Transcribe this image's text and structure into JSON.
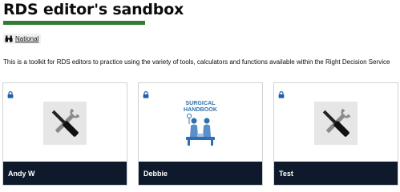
{
  "page": {
    "title": "RDS editor's sandbox",
    "tag_label": "National",
    "intro": "This is a toolkit for RDS editors to practice using the variety of tools, calculators and functions available within the Right Decision Service"
  },
  "colors": {
    "title_underline": "#2e7d32",
    "card_footer": "#0e1a2b",
    "lock": "#1d5fa8",
    "book_accent": "#2f6fb0"
  },
  "cards": [
    {
      "name": "Andy W",
      "thumbnail": "tools-icon",
      "locked": true
    },
    {
      "name": "Debbie",
      "thumbnail": "surgical-handbook-cover",
      "locked": true,
      "cover_title_line1": "SURGICAL",
      "cover_title_line2": "HANDBOOK"
    },
    {
      "name": "Test",
      "thumbnail": "tools-icon",
      "locked": true
    }
  ]
}
